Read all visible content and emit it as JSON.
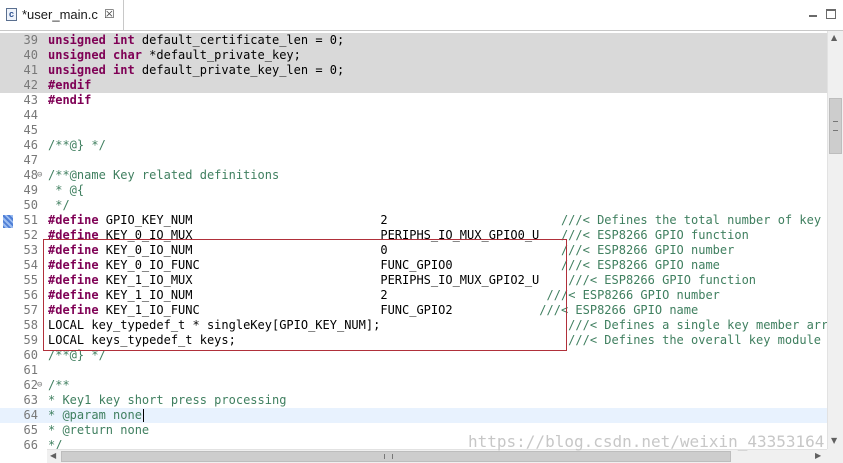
{
  "tab": {
    "icon": "c-file-icon",
    "icon_letter": "c",
    "label": "*user_main.c",
    "close": "☒"
  },
  "editor": {
    "lines": [
      {
        "n": "39",
        "hl": "grey",
        "segs": [
          [
            "kw",
            "unsigned int"
          ],
          [
            "norm",
            " default_certificate_len = 0;"
          ]
        ]
      },
      {
        "n": "40",
        "hl": "grey",
        "segs": [
          [
            "kw",
            "unsigned char"
          ],
          [
            "norm",
            " *default_private_key;"
          ]
        ]
      },
      {
        "n": "41",
        "hl": "grey",
        "segs": [
          [
            "kw",
            "unsigned int"
          ],
          [
            "norm",
            " default_private_key_len = 0;"
          ]
        ]
      },
      {
        "n": "42",
        "hl": "grey",
        "segs": [
          [
            "pp",
            "#endif"
          ]
        ]
      },
      {
        "n": "43",
        "segs": [
          [
            "pp",
            "#endif"
          ]
        ]
      },
      {
        "n": "44",
        "segs": []
      },
      {
        "n": "45",
        "segs": []
      },
      {
        "n": "46",
        "segs": [
          [
            "com",
            "/**@} */"
          ]
        ]
      },
      {
        "n": "47",
        "segs": []
      },
      {
        "n": "48",
        "fold": true,
        "segs": [
          [
            "com",
            "/**@name Key related definitions"
          ]
        ]
      },
      {
        "n": "49",
        "segs": [
          [
            "com",
            " * @{"
          ]
        ]
      },
      {
        "n": "50",
        "segs": [
          [
            "com",
            " */"
          ]
        ]
      },
      {
        "n": "51",
        "segs": [
          [
            "pp",
            "#define"
          ],
          [
            "norm",
            " GPIO_KEY_NUM                          2                        "
          ],
          [
            "com",
            "///< Defines the total number of key members"
          ]
        ]
      },
      {
        "n": "52",
        "segs": [
          [
            "pp",
            "#define"
          ],
          [
            "norm",
            " KEY_0_IO_MUX                          PERIPHS_IO_MUX_GPIO0_U   "
          ],
          [
            "com",
            "///< ESP8266 GPIO function"
          ]
        ]
      },
      {
        "n": "53",
        "segs": [
          [
            "pp",
            "#define"
          ],
          [
            "norm",
            " KEY_0_IO_NUM                          0                        "
          ],
          [
            "com",
            "///< ESP8266 GPIO number"
          ]
        ]
      },
      {
        "n": "54",
        "segs": [
          [
            "pp",
            "#define"
          ],
          [
            "norm",
            " KEY_0_IO_FUNC                         FUNC_GPIO0               "
          ],
          [
            "com",
            "///< ESP8266 GPIO name"
          ]
        ]
      },
      {
        "n": "55",
        "segs": [
          [
            "pp",
            "#define"
          ],
          [
            "norm",
            " KEY_1_IO_MUX                          PERIPHS_IO_MUX_GPIO2_U    "
          ],
          [
            "com",
            "///< ESP8266 GPIO function"
          ]
        ]
      },
      {
        "n": "56",
        "segs": [
          [
            "pp",
            "#define"
          ],
          [
            "norm",
            " KEY_1_IO_NUM                          2                      "
          ],
          [
            "com",
            "///< ESP8266 GPIO number"
          ]
        ]
      },
      {
        "n": "57",
        "segs": [
          [
            "pp",
            "#define"
          ],
          [
            "norm",
            " KEY_1_IO_FUNC                         FUNC_GPIO2            "
          ],
          [
            "com",
            "///< ESP8266 GPIO name"
          ]
        ]
      },
      {
        "n": "58",
        "segs": [
          [
            "norm",
            "LOCAL key_typedef_t * singleKey[GPIO_KEY_NUM];                          "
          ],
          [
            "com",
            "///< Defines a single key member array pointer"
          ]
        ]
      },
      {
        "n": "59",
        "segs": [
          [
            "norm",
            "LOCAL keys_typedef_t keys;                                              "
          ],
          [
            "com",
            "///< Defines the overall key module structure pointer"
          ]
        ]
      },
      {
        "n": "60",
        "segs": [
          [
            "com",
            "/**@} */"
          ]
        ]
      },
      {
        "n": "61",
        "segs": []
      },
      {
        "n": "62",
        "fold": true,
        "segs": [
          [
            "com",
            "/**"
          ]
        ]
      },
      {
        "n": "63",
        "segs": [
          [
            "com",
            "* Key1 key short press processing"
          ]
        ]
      },
      {
        "n": "64",
        "hl": "blue",
        "caret": true,
        "segs": [
          [
            "com",
            "* @param none"
          ]
        ]
      },
      {
        "n": "65",
        "segs": [
          [
            "com",
            "* @return none"
          ]
        ]
      },
      {
        "n": "66",
        "segs": [
          [
            "com",
            "*/"
          ]
        ]
      }
    ]
  },
  "watermark": "https://blog.csdn.net/weixin_43353164",
  "scrollbars": {
    "up": "▲",
    "down": "▼",
    "left": "◀",
    "right": "▶"
  },
  "colors": {
    "keyword": "#7f0055",
    "comment": "#3f7f5f",
    "line_highlight": "#e8f2fe",
    "selection_box": "#b0303a"
  }
}
